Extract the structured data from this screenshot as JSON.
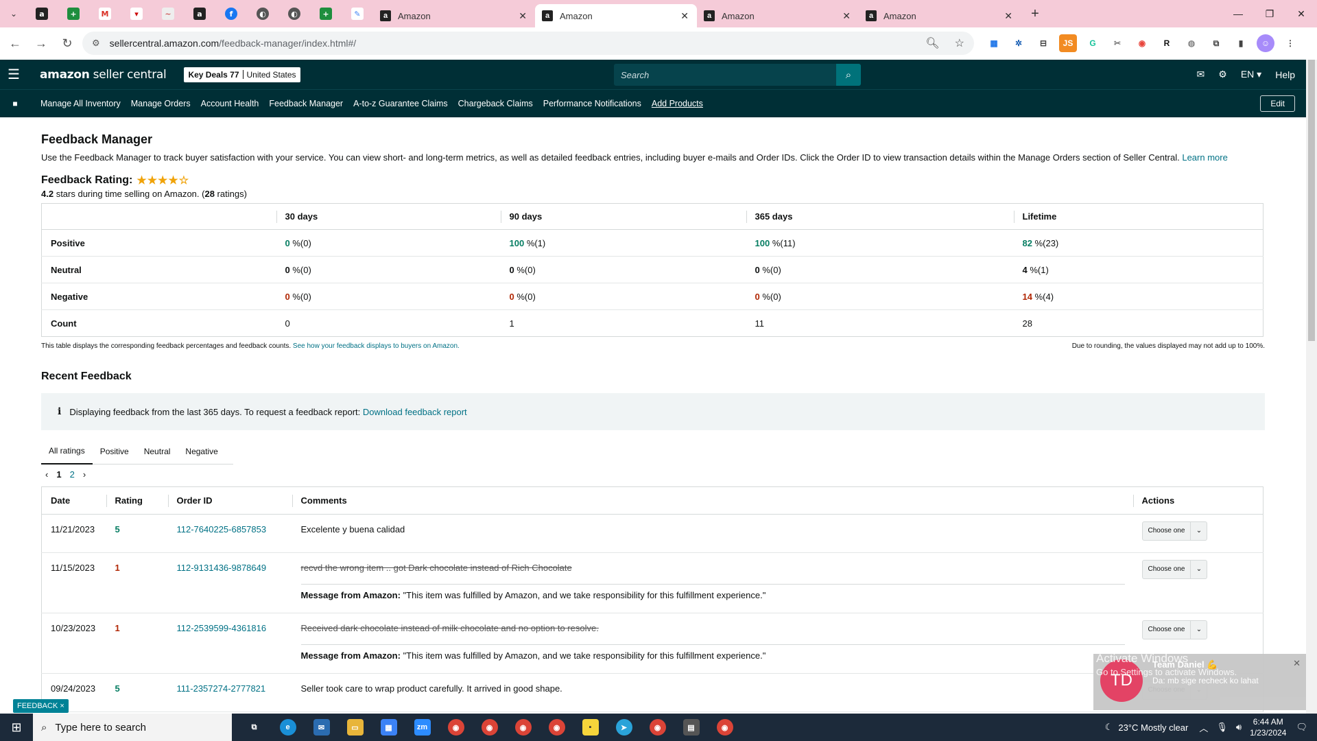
{
  "browser": {
    "tabs": [
      {
        "title": "Amazon",
        "active": false
      },
      {
        "title": "Amazon",
        "active": true
      },
      {
        "title": "Amazon",
        "active": false
      },
      {
        "title": "Amazon",
        "active": false
      }
    ],
    "url_host": "sellercentral.amazon.com",
    "url_path": "/feedback-manager/index.html#/"
  },
  "header": {
    "logo_bold": "amazon",
    "logo_rest": " seller central",
    "store_name": "Key Deals 77",
    "store_region": "United States",
    "search_placeholder": "Search",
    "language": "EN",
    "help": "Help"
  },
  "nav": {
    "items": [
      "Manage All Inventory",
      "Manage Orders",
      "Account Health",
      "Feedback Manager",
      "A-to-z Guarantee Claims",
      "Chargeback Claims",
      "Performance Notifications",
      "Add Products"
    ],
    "edit": "Edit"
  },
  "page": {
    "title": "Feedback Manager",
    "intro": "Use the Feedback Manager to track buyer satisfaction with your service. You can view short- and long-term metrics, as well as detailed feedback entries, including buyer e-mails and Order IDs. Click the Order ID to view transaction details within the Manage Orders section of Seller Central.",
    "learn_more": "Learn more",
    "rating_title": "Feedback Rating:",
    "rating_value": 4.2,
    "rating_stars": "4.2",
    "rating_mid": " stars during time selling on Amazon. (",
    "rating_count": "28",
    "rating_end": " ratings)"
  },
  "rating_table": {
    "columns": [
      "30 days",
      "90 days",
      "365 days",
      "Lifetime"
    ],
    "rows": [
      {
        "label": "Positive",
        "cells": [
          {
            "v": "0",
            "t": " %(0)"
          },
          {
            "v": "100",
            "t": " %(1)"
          },
          {
            "v": "100",
            "t": " %(11)"
          },
          {
            "v": "82",
            "t": " %(23)"
          }
        ]
      },
      {
        "label": "Neutral",
        "cells": [
          {
            "v": "0",
            "t": " %(0)"
          },
          {
            "v": "0",
            "t": " %(0)"
          },
          {
            "v": "0",
            "t": " %(0)"
          },
          {
            "v": "4",
            "t": " %(1)"
          }
        ]
      },
      {
        "label": "Negative",
        "cells": [
          {
            "v": "0",
            "t": " %(0)"
          },
          {
            "v": "0",
            "t": " %(0)"
          },
          {
            "v": "0",
            "t": " %(0)"
          },
          {
            "v": "14",
            "t": " %(4)"
          }
        ]
      },
      {
        "label": "Count",
        "cells": [
          {
            "v": "0",
            "t": ""
          },
          {
            "v": "1",
            "t": ""
          },
          {
            "v": "11",
            "t": ""
          },
          {
            "v": "28",
            "t": ""
          }
        ]
      }
    ],
    "foot_left": "This table displays the corresponding feedback percentages and feedback counts.",
    "foot_link": "See how your feedback displays to buyers on Amazon.",
    "foot_right": "Due to rounding, the values displayed may not add up to 100%."
  },
  "recent": {
    "title": "Recent Feedback",
    "alert_text": "Displaying feedback from the last 365 days. To request a feedback report:",
    "alert_link": "Download feedback report",
    "tabs": [
      "All ratings",
      "Positive",
      "Neutral",
      "Negative"
    ],
    "pages": [
      "1",
      "2"
    ],
    "columns": [
      "Date",
      "Rating",
      "Order ID",
      "Comments",
      "Actions"
    ],
    "rows": [
      {
        "date": "11/21/2023",
        "rating": "5",
        "order": "112-7640225-6857853",
        "comment": "Excelente y buena calidad",
        "struck": false,
        "message": ""
      },
      {
        "date": "11/15/2023",
        "rating": "1",
        "order": "112-9131436-9878649",
        "comment": "recvd the wrong item .. got Dark chocolate instead of Rich Chocolate",
        "struck": true,
        "message": "\"This item was fulfilled by Amazon, and we take responsibility for this fulfillment experience.\""
      },
      {
        "date": "10/23/2023",
        "rating": "1",
        "order": "112-2539599-4361816",
        "comment": "Received dark chocolate instead of milk chocolate and no option to resolve.",
        "struck": true,
        "message": "\"This item was fulfilled by Amazon, and we take responsibility for this fulfillment experience.\""
      },
      {
        "date": "09/24/2023",
        "rating": "5",
        "order": "111-2357274-2777821",
        "comment": "Seller took care to wrap product carefully. It arrived in good shape.",
        "struck": false,
        "message": ""
      }
    ],
    "message_label": "Message from Amazon:",
    "action_label": "Choose one"
  },
  "feedback_tab": "FEEDBACK ×",
  "toast": {
    "initials": "TD",
    "name": "Team Daniel 💪",
    "message": "Da: mb sige recheck ko lahat",
    "watermark1": "Activate Windows",
    "watermark2": "Go to Settings to activate Windows."
  },
  "taskbar": {
    "search_placeholder": "Type here to search",
    "weather": "23°C  Mostly clear",
    "time": "6:44 AM",
    "date": "1/23/2024"
  },
  "colors": {
    "header_bg": "#002f36",
    "link": "#007185",
    "positive": "#067d62",
    "negative": "#b12704",
    "star": "#f0a30a"
  }
}
